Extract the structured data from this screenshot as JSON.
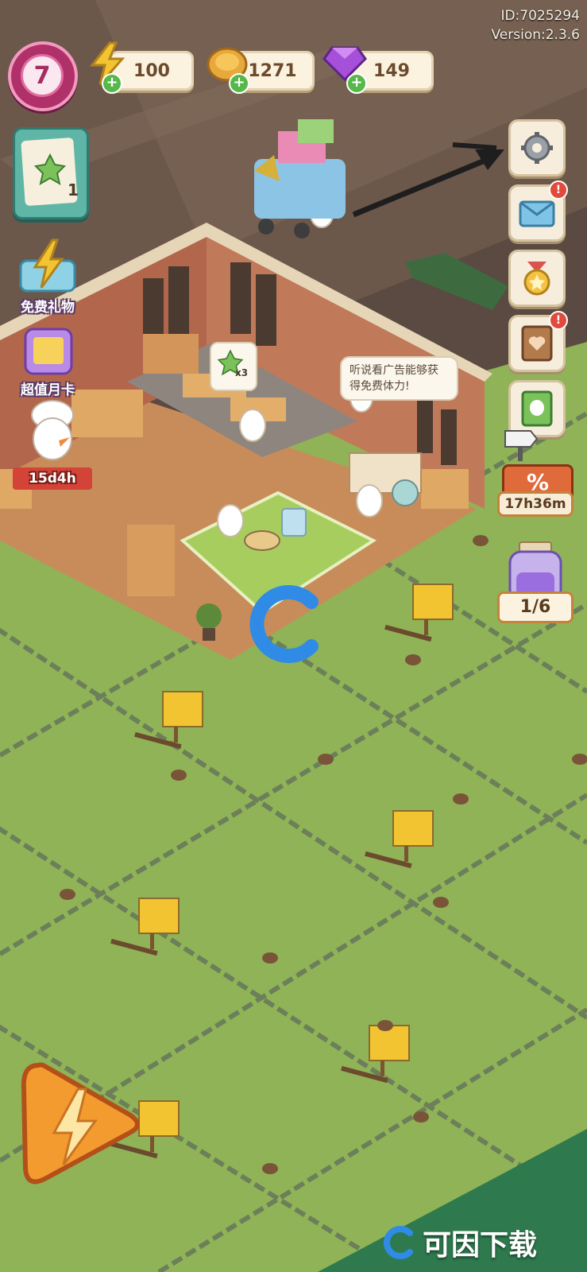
{
  "header": {
    "player_id": "ID:7025294",
    "version": "Version:2.3.6",
    "level": "7"
  },
  "resources": {
    "energy": "100",
    "coins": "1271",
    "gems": "149",
    "colors": {
      "energy": "#f3c431",
      "coins": "#e7a93b",
      "gems": "#a64fd8"
    }
  },
  "left_menu": {
    "task_count": "1",
    "free_gift_label": "免费礼物",
    "monthly_card_label": "超值月卡",
    "event_timer": "15d4h"
  },
  "right_menu": {
    "items": [
      {
        "name": "settings",
        "icon": "gear-icon",
        "badge": ""
      },
      {
        "name": "mail",
        "icon": "mail-icon",
        "badge": "!"
      },
      {
        "name": "achievements",
        "icon": "medal-icon",
        "badge": ""
      },
      {
        "name": "journal",
        "icon": "heart-book-icon",
        "badge": "!"
      },
      {
        "name": "guide",
        "icon": "duck-book-icon",
        "badge": ""
      }
    ],
    "sale_timer": "17h36m",
    "jar_progress": "1/6"
  },
  "shop": {
    "speech_bubble": "听说看广告能够获得免费体力!",
    "item_multiplier": "x3"
  },
  "watermark": "可因下载"
}
